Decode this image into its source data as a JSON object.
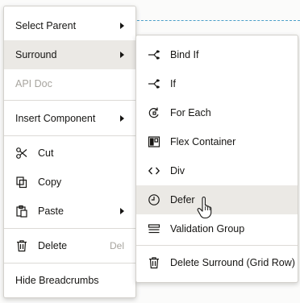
{
  "main_menu": {
    "items": [
      {
        "label": "Select Parent"
      },
      {
        "label": "Surround"
      },
      {
        "label": "API Doc"
      },
      {
        "label": "Insert Component"
      },
      {
        "label": "Cut",
        "icon": "scissors-icon"
      },
      {
        "label": "Copy",
        "icon": "copy-icon"
      },
      {
        "label": "Paste",
        "icon": "clipboard-icon"
      },
      {
        "label": "Delete",
        "icon": "trash-icon",
        "shortcut": "Del"
      },
      {
        "label": "Hide Breadcrumbs"
      }
    ]
  },
  "sub_menu": {
    "items": [
      {
        "label": "Bind If",
        "icon": "branch-icon"
      },
      {
        "label": "If",
        "icon": "branch-icon"
      },
      {
        "label": "For Each",
        "icon": "loop-icon"
      },
      {
        "label": "Flex Container",
        "icon": "flex-layout-icon"
      },
      {
        "label": "Div",
        "icon": "code-brackets-icon"
      },
      {
        "label": "Defer",
        "icon": "clock-icon"
      },
      {
        "label": "Validation Group",
        "icon": "stacked-lines-icon"
      },
      {
        "label": "Delete Surround (Grid Row)",
        "icon": "trash-icon"
      }
    ]
  },
  "colors": {
    "highlight": "#ebe9e5",
    "disabled_text": "#a7a49e",
    "selection_dash": "#4b9fc9"
  }
}
